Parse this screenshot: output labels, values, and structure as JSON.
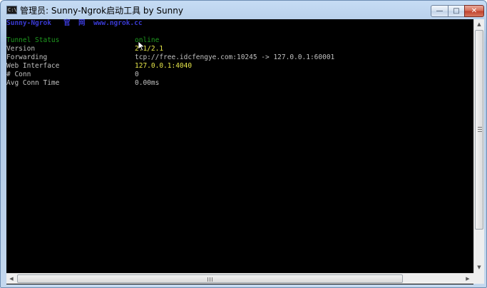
{
  "window": {
    "title": "管理员:  Sunny-Ngrok启动工具 by Sunny",
    "icon_label": "C:\\",
    "buttons": {
      "minimize": "—",
      "maximize": "□",
      "close": "✕"
    }
  },
  "console": {
    "header": "Sunny-Ngrok   官  网  www.ngrok.cc",
    "status_label": "Tunnel Status",
    "status_value": "online",
    "rows": [
      {
        "label": "Version",
        "value": "2.1/2.1"
      },
      {
        "label": "Forwarding",
        "value": "tcp://free.idcfengye.com:10245 -> 127.0.0.1:60001"
      },
      {
        "label": "Web Interface",
        "value": "127.0.0.1:4040"
      },
      {
        "label": "# Conn",
        "value": "0"
      },
      {
        "label": "Avg Conn Time",
        "value": "0.00ms"
      }
    ]
  },
  "colors": {
    "header": "#3a3ad4",
    "status": "#1f9a1f",
    "label": "#c0c0c0",
    "value": "#e8e84a",
    "background": "#000000"
  },
  "icons": {
    "scroll_up": "▲",
    "scroll_down": "▼",
    "scroll_left": "◀",
    "scroll_right": "▶"
  }
}
